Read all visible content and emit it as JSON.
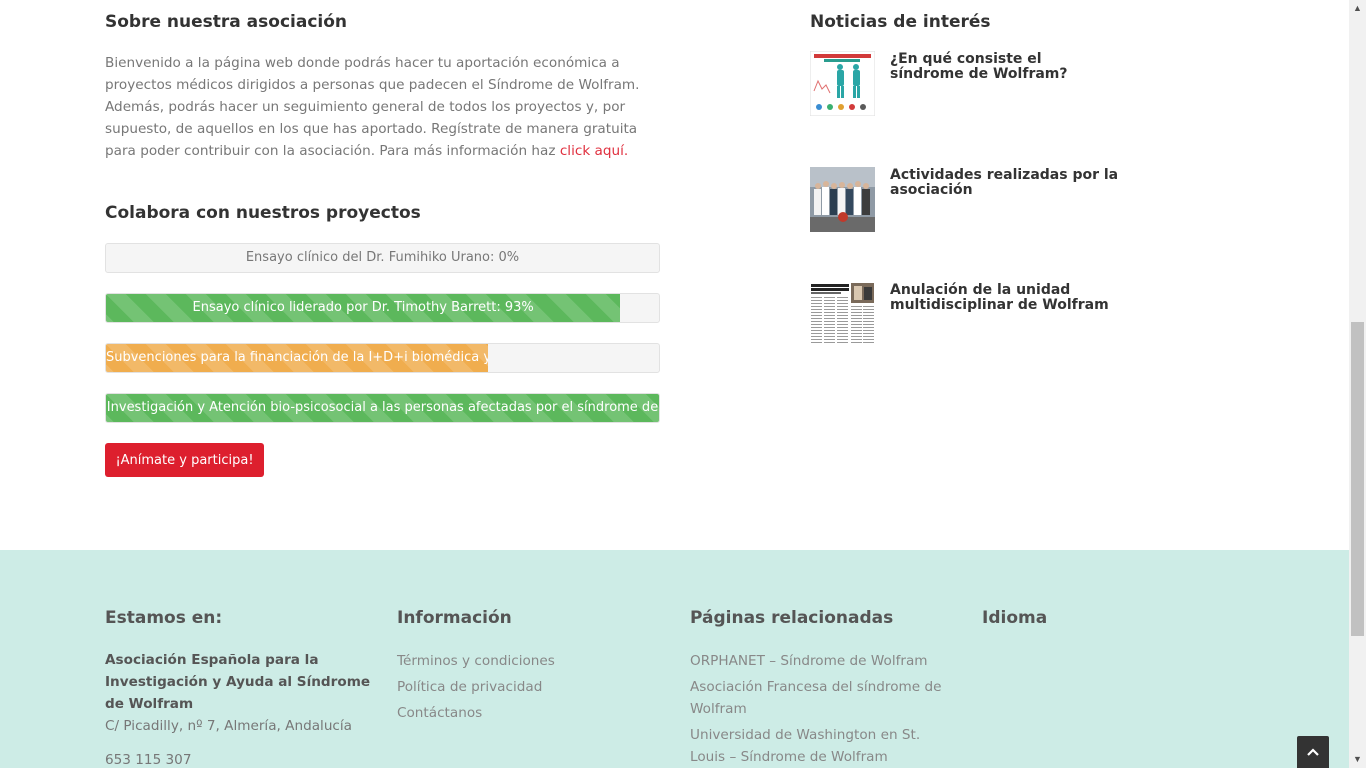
{
  "about": {
    "title": "Sobre nuestra asociación",
    "text": "Bienvenido a la página web donde podrás hacer tu aportación económica a proyectos médicos dirigidos a personas que padecen el Síndrome de Wolfram. Además, podrás hacer un seguimiento general de todos los proyectos y, por supuesto, de aquellos en los que has aportado. Regístrate de manera gratuita para poder contribuir con la asociación. Para más información haz ",
    "link": "click aquí."
  },
  "projects": {
    "title": "Colabora con nuestros proyectos",
    "items": [
      {
        "label": "Ensayo clínico del Dr. Fumihiko Urano: 0%",
        "progress": 0,
        "color": "#5cb85c"
      },
      {
        "label": "Ensayo clínico liderado por Dr. Timothy Barrett: 93%",
        "progress": 93,
        "color": "#5cb85c"
      },
      {
        "label": "Subvenciones para la financiación de la I+D+i biomédica y en",
        "progress": 69,
        "color": "#f0ad4e"
      },
      {
        "label": "Investigación y Atención bio-psicosocial a las personas afectadas por el síndrome de",
        "progress": 100,
        "color": "#5cb85c"
      }
    ],
    "cta": "¡Anímate y participa!"
  },
  "news": {
    "title": "Noticias de interés",
    "items": [
      {
        "title": "¿En qué consiste el síndrome de Wolfram?"
      },
      {
        "title": "Actividades realizadas por la asociación"
      },
      {
        "title": "Anulación de la unidad multidisciplinar de Wolfram"
      }
    ]
  },
  "footer": {
    "location": {
      "heading": "Estamos en:",
      "org": "Asociación Española para la Investigación y Ayuda al Síndrome de Wolfram",
      "address": "C/ Picadilly, nº 7, Almería, Andalucía",
      "phone": "653 115 307"
    },
    "info": {
      "heading": "Información",
      "links": [
        "Términos y condiciones",
        "Política de privacidad",
        "Contáctanos"
      ]
    },
    "related": {
      "heading": "Páginas relacionadas",
      "links": [
        "ORPHANET – Síndrome de Wolfram",
        "Asociación Francesa del síndrome de Wolfram",
        "Universidad de Washington en St. Louis – Síndrome de Wolfram"
      ]
    },
    "language": {
      "heading": "Idioma"
    }
  },
  "colors": {
    "accent_red": "#dd1f2e",
    "footer_bg": "#cdece6",
    "progress_green": "#5cb85c",
    "progress_orange": "#f0ad4e"
  }
}
